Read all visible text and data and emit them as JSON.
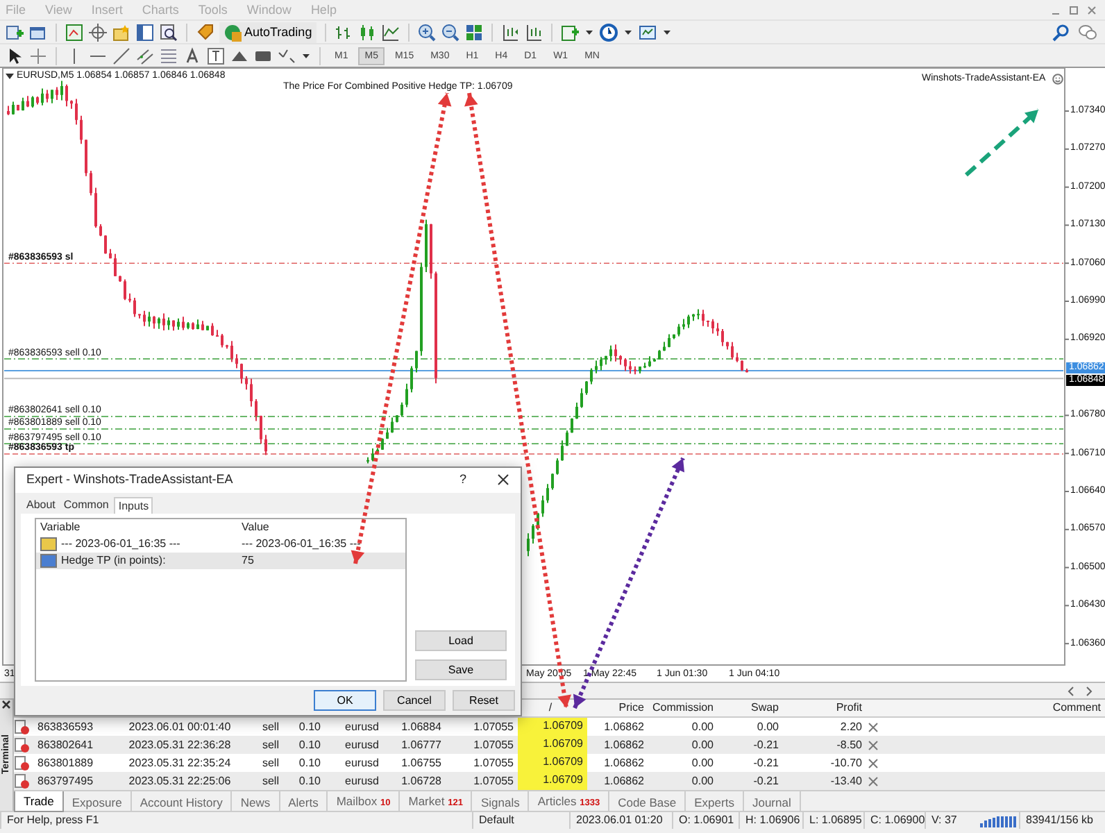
{
  "menu": [
    {
      "label": "File",
      "disabled": true
    },
    {
      "label": "View",
      "disabled": true
    },
    {
      "label": "Insert",
      "disabled": true
    },
    {
      "label": "Charts",
      "disabled": true
    },
    {
      "label": "Tools",
      "disabled": true
    },
    {
      "label": "Window",
      "disabled": true
    },
    {
      "label": "Help",
      "disabled": true
    }
  ],
  "toolbar": {
    "autotrading": "AutoTrading",
    "timeframes": [
      {
        "label": "M1",
        "selected": false
      },
      {
        "label": "M5",
        "selected": true
      },
      {
        "label": "M15",
        "selected": false
      },
      {
        "label": "M30",
        "selected": false
      },
      {
        "label": "H1",
        "selected": false
      },
      {
        "label": "H4",
        "selected": false
      },
      {
        "label": "D1",
        "selected": false
      },
      {
        "label": "W1",
        "selected": false
      },
      {
        "label": "MN",
        "selected": false
      }
    ]
  },
  "chart": {
    "symbol_info": "EURUSD,M5 1.06854 1.06857 1.06846 1.06848",
    "hedge_tp_text": "The Price For Combined Positive Hedge TP: 1.06709",
    "ea_name": "Winshots-TradeAssistant-EA",
    "order_lines": [
      {
        "label": "#863836593 sl",
        "kind": "sl"
      },
      {
        "label": "#863836593 sell 0.10",
        "kind": "sell"
      },
      {
        "label": "#863802641 sell 0.10",
        "kind": "sell"
      },
      {
        "label": "#863801889 sell 0.10",
        "kind": "sell"
      },
      {
        "label": "#863797495 sell 0.10",
        "kind": "sell"
      },
      {
        "label": "#863836593 tp",
        "kind": "tp"
      }
    ],
    "price_axis": [
      "1.07340",
      "1.07270",
      "1.07200",
      "1.07130",
      "1.07060",
      "1.06990",
      "1.06920",
      "1.06780",
      "1.06710",
      "1.06640",
      "1.06570",
      "1.06500",
      "1.06430",
      "1.06360"
    ],
    "ask_tag": "1.06862",
    "bid_tag": "1.06848",
    "time_axis": [
      "31",
      "May 20:05",
      "1 May 22:45",
      "1 Jun 01:30",
      "1 Jun 04:10"
    ]
  },
  "dialog": {
    "title": "Expert - Winshots-TradeAssistant-EA",
    "help": "?",
    "tabs": [
      {
        "label": "About",
        "selected": false
      },
      {
        "label": "Common",
        "selected": false
      },
      {
        "label": "Inputs",
        "selected": true
      }
    ],
    "columns": [
      "Variable",
      "Value"
    ],
    "rows": [
      {
        "variable": "--- 2023-06-01_16:35 ---",
        "value": "--- 2023-06-01_16:35 ---",
        "kind": "string",
        "selected": false
      },
      {
        "variable": "Hedge TP (in points):",
        "value": "75",
        "kind": "int",
        "selected": true
      }
    ],
    "side_buttons": [
      "Load",
      "Save"
    ],
    "buttons": [
      {
        "label": "OK",
        "default": true
      },
      {
        "label": "Cancel",
        "default": false
      },
      {
        "label": "Reset",
        "default": false
      }
    ]
  },
  "terminal": {
    "side_label": "Terminal",
    "columns": [
      "/",
      "Price",
      "Commission",
      "Swap",
      "Profit",
      "Comment"
    ],
    "rows": [
      {
        "ticket": "863836593",
        "time": "2023.06.01 00:01:40",
        "type": "sell",
        "size": "0.10",
        "symbol": "eurusd",
        "price": "1.06884",
        "sl": "1.07055",
        "tp": "1.06709",
        "tp_highlighted": true,
        "current": "1.06862",
        "commission": "0.00",
        "swap": "0.00",
        "profit": "2.20"
      },
      {
        "ticket": "863802641",
        "time": "2023.05.31 22:36:28",
        "type": "sell",
        "size": "0.10",
        "symbol": "eurusd",
        "price": "1.06777",
        "sl": "1.07055",
        "tp": "1.06709",
        "tp_highlighted": true,
        "current": "1.06862",
        "commission": "0.00",
        "swap": "-0.21",
        "profit": "-8.50"
      },
      {
        "ticket": "863801889",
        "time": "2023.05.31 22:35:24",
        "type": "sell",
        "size": "0.10",
        "symbol": "eurusd",
        "price": "1.06755",
        "sl": "1.07055",
        "tp": "1.06709",
        "tp_highlighted": true,
        "current": "1.06862",
        "commission": "0.00",
        "swap": "-0.21",
        "profit": "-10.70"
      },
      {
        "ticket": "863797495",
        "time": "2023.05.31 22:25:06",
        "type": "sell",
        "size": "0.10",
        "symbol": "eurusd",
        "price": "1.06728",
        "sl": "1.07055",
        "tp": "1.06709",
        "tp_highlighted": true,
        "current": "1.06862",
        "commission": "0.00",
        "swap": "-0.21",
        "profit": "-13.40"
      }
    ],
    "tabs": [
      {
        "label": "Trade",
        "selected": true
      },
      {
        "label": "Exposure",
        "selected": false
      },
      {
        "label": "Account History",
        "selected": false
      },
      {
        "label": "News",
        "selected": false
      },
      {
        "label": "Alerts",
        "selected": false
      },
      {
        "label": "Mailbox",
        "count": "10",
        "selected": false
      },
      {
        "label": "Market",
        "count": "121",
        "selected": false
      },
      {
        "label": "Signals",
        "selected": false
      },
      {
        "label": "Articles",
        "count": "1333",
        "selected": false
      },
      {
        "label": "Code Base",
        "selected": false
      },
      {
        "label": "Experts",
        "selected": false
      },
      {
        "label": "Journal",
        "selected": false
      }
    ]
  },
  "status_bar": {
    "help": "For Help, press F1",
    "profile": "Default",
    "datetime": "2023.06.01 01:20",
    "open": "O: 1.06901",
    "high": "H: 1.06906",
    "low": "L: 1.06895",
    "close": "C: 1.06900",
    "volume": "V: 37",
    "traffic": "83941/156 kb"
  }
}
